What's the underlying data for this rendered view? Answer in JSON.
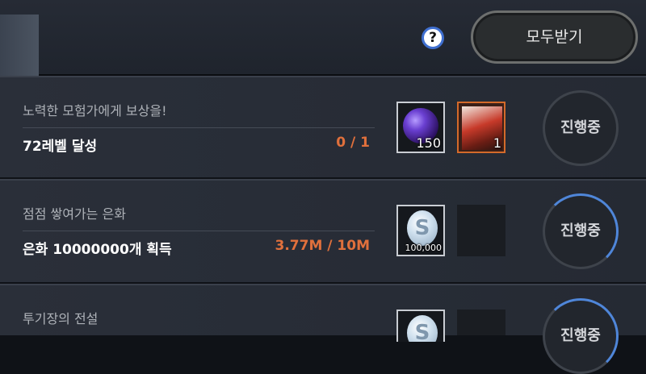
{
  "header": {
    "help_label": "?",
    "claim_all_label": "모두받기"
  },
  "quests": [
    {
      "title": "노력한 모험가에게 보상을!",
      "goal": "72레벨 달성",
      "progress": "0 / 1",
      "rewards": [
        {
          "icon": "purple-orb-icon",
          "qty": "150"
        },
        {
          "icon": "hero-card-icon",
          "qty": "1"
        }
      ],
      "status": "진행중"
    },
    {
      "title": "점점 쌓여가는 은화",
      "goal": "은화 10000000개 획득",
      "progress": "3.77M / 10M",
      "rewards": [
        {
          "icon": "silver-coin-icon",
          "qty": "100,000"
        }
      ],
      "status": "진행중"
    },
    {
      "title": "투기장의 전설",
      "status": "진행중"
    }
  ],
  "colors": {
    "progress_text": "#e0703c",
    "accent_ring": "#4f86d9"
  }
}
